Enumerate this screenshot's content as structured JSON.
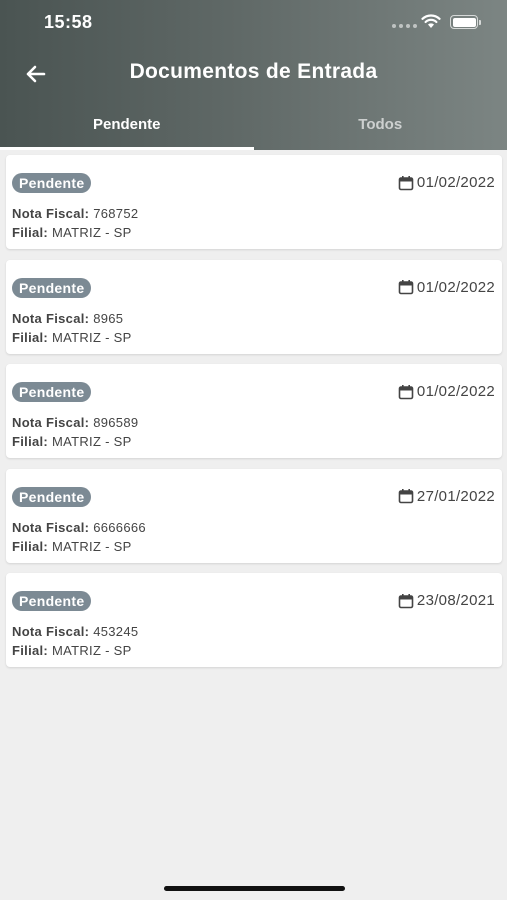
{
  "status_bar": {
    "time": "15:58"
  },
  "header": {
    "title": "Documentos de Entrada"
  },
  "tabs": [
    {
      "label": "Pendente",
      "active": true
    },
    {
      "label": "Todos",
      "active": false
    }
  ],
  "labels": {
    "nota_fiscal": "Nota Fiscal:",
    "filial": "Filial:"
  },
  "documents": [
    {
      "status": "Pendente",
      "date": "01/02/2022",
      "nota_fiscal": "768752",
      "filial": "MATRIZ - SP"
    },
    {
      "status": "Pendente",
      "date": "01/02/2022",
      "nota_fiscal": "8965",
      "filial": "MATRIZ - SP"
    },
    {
      "status": "Pendente",
      "date": "01/02/2022",
      "nota_fiscal": "896589",
      "filial": "MATRIZ - SP"
    },
    {
      "status": "Pendente",
      "date": "27/01/2022",
      "nota_fiscal": "6666666",
      "filial": "MATRIZ - SP"
    },
    {
      "status": "Pendente",
      "date": "23/08/2021",
      "nota_fiscal": "453245",
      "filial": "MATRIZ - SP"
    }
  ],
  "icons": {
    "back": "arrow-left-icon",
    "calendar": "calendar-icon",
    "wifi": "wifi-icon",
    "battery": "battery-icon",
    "signal": "signal-icon"
  },
  "colors": {
    "header_start": "#4a5452",
    "header_end": "#7c8583",
    "badge": "#7c8a94",
    "background": "#efefef"
  }
}
